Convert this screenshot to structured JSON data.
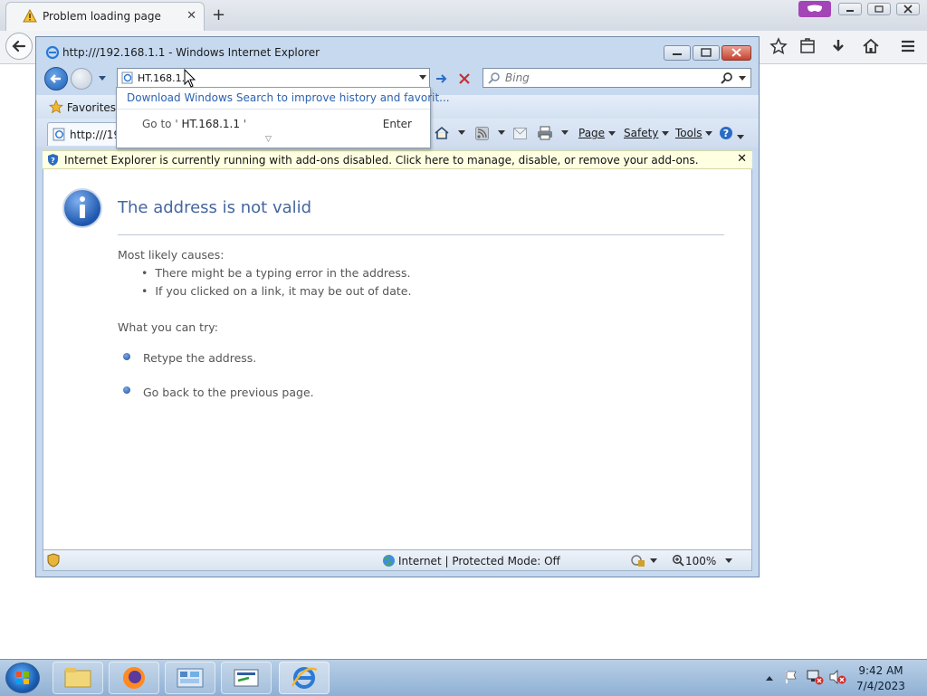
{
  "firefox": {
    "tab_title": "Problem loading page",
    "new_tab_symbol": "+",
    "tab_close_symbol": "✕"
  },
  "ie": {
    "window_title": "http:///192.168.1.1 - Windows Internet Explorer",
    "address_value": "HT.168.1.1",
    "search_placeholder": "Bing",
    "favorites_label": "Favorites",
    "tab_label": "http:///19",
    "commands": {
      "page": "Page",
      "safety": "Safety",
      "tools": "Tools"
    },
    "infobar_text": "Internet Explorer is currently running with add-ons disabled. Click here to manage, disable, or remove your add-ons.",
    "infobar_close": "✕",
    "autocomplete": {
      "download_link": "Download Windows Search to improve history and favorit...",
      "goto_prefix": "Go to '",
      "goto_value": "HT.168.1.1",
      "goto_suffix": "'",
      "enter_label": "Enter",
      "more_symbol": "▽"
    },
    "status": {
      "zone": "Internet | Protected Mode: Off",
      "zoom": "100%"
    }
  },
  "error_page": {
    "title": "The address is not valid",
    "causes_heading": "Most likely causes:",
    "causes": [
      "There might be a typing error in the address.",
      "If you clicked on a link, it may be out of date."
    ],
    "try_heading": "What you can try:",
    "tries": [
      "Retype the address.",
      "Go back to the previous page."
    ]
  },
  "taskbar": {
    "time": "9:42 AM",
    "date": "7/4/2023"
  },
  "icons": {
    "ff_warning": "warning-triangle-icon",
    "ff_back": "back-arrow-icon",
    "bookmark": "star-icon",
    "library": "library-icon",
    "download": "download-arrow-icon",
    "home": "home-icon",
    "menu": "hamburger-menu-icon",
    "private": "mask-icon"
  },
  "colors": {
    "ie_frame": "#c6d9ef",
    "infobar_bg": "#ffffe1",
    "error_title": "#4466a0",
    "link": "#2d62b0",
    "private_badge": "#a445b7"
  }
}
